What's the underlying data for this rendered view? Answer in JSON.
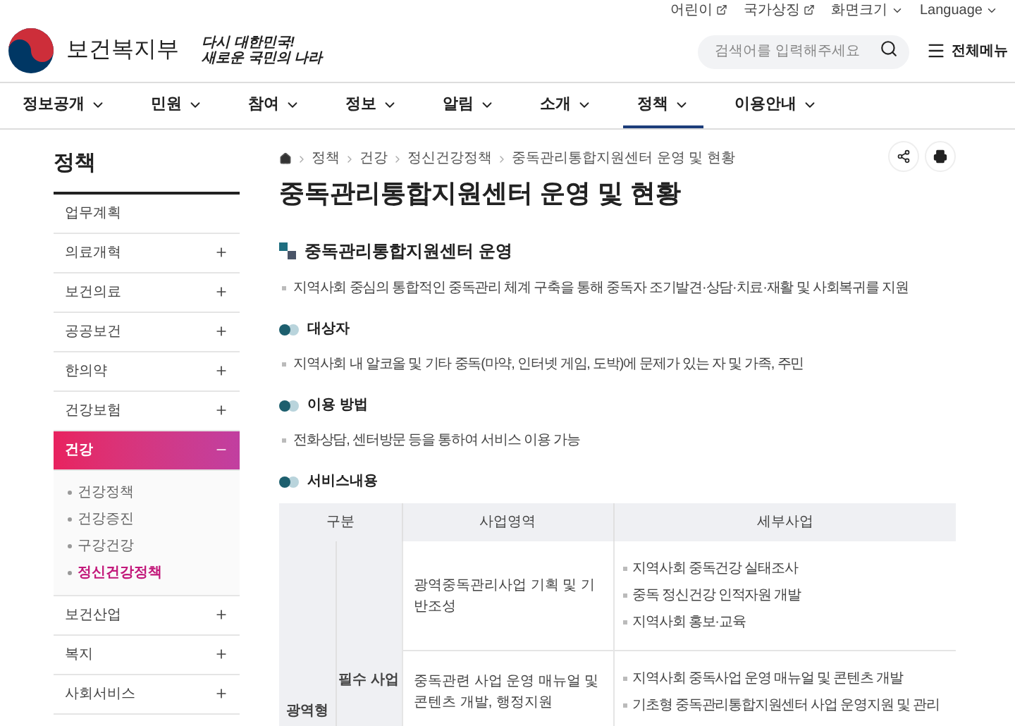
{
  "utility_links": [
    {
      "label": "어린이",
      "kind": "external"
    },
    {
      "label": "국가상징",
      "kind": "external"
    },
    {
      "label": "화면크기",
      "kind": "dropdown"
    },
    {
      "label": "Language",
      "kind": "dropdown"
    }
  ],
  "logo": {
    "name": "보건복지부",
    "slogan_lines": [
      "다시 대한민국!",
      "새로운 국민의 나라"
    ]
  },
  "search": {
    "placeholder": "검색어를 입력해주세요"
  },
  "all_menu": "전체메뉴",
  "nav": [
    {
      "label": "정보공개",
      "selected": false
    },
    {
      "label": "민원",
      "selected": false
    },
    {
      "label": "참여",
      "selected": false
    },
    {
      "label": "정보",
      "selected": false
    },
    {
      "label": "알림",
      "selected": false
    },
    {
      "label": "소개",
      "selected": false
    },
    {
      "label": "정책",
      "selected": true
    },
    {
      "label": "이용안내",
      "selected": false
    }
  ],
  "sidebar": {
    "title": "정책",
    "items": [
      {
        "label": "업무계획",
        "expandable": false,
        "expanded": false
      },
      {
        "label": "의료개혁",
        "expandable": true,
        "expanded": false
      },
      {
        "label": "보건의료",
        "expandable": true,
        "expanded": false
      },
      {
        "label": "공공보건",
        "expandable": true,
        "expanded": false
      },
      {
        "label": "한의약",
        "expandable": true,
        "expanded": false
      },
      {
        "label": "건강보험",
        "expandable": true,
        "expanded": false
      },
      {
        "label": "건강",
        "expandable": true,
        "expanded": true,
        "children": [
          {
            "label": "건강정책",
            "selected": false
          },
          {
            "label": "건강증진",
            "selected": false
          },
          {
            "label": "구강건강",
            "selected": false
          },
          {
            "label": "정신건강정책",
            "selected": true
          }
        ]
      },
      {
        "label": "보건산업",
        "expandable": true,
        "expanded": false
      },
      {
        "label": "복지",
        "expandable": true,
        "expanded": false
      },
      {
        "label": "사회서비스",
        "expandable": true,
        "expanded": false
      }
    ]
  },
  "breadcrumb": [
    "정책",
    "건강",
    "정신건강정책",
    "중독관리통합지원센터 운영 및 현황"
  ],
  "page_title": "중독관리통합지원센터 운영 및 현황",
  "sections": [
    {
      "kind": "main",
      "heading": "중독관리통합지원센터 운영",
      "bullets": [
        "지역사회 중심의 통합적인 중독관리 체계 구축을 통해 중독자 조기발견·상담·치료·재활 및 사회복귀를 지원"
      ]
    },
    {
      "kind": "sub",
      "heading": "대상자",
      "bullets": [
        "지역사회 내 알코올 및 기타 중독(마약, 인터넷 게임, 도박)에 문제가 있는 자 및 가족, 주민"
      ]
    },
    {
      "kind": "sub",
      "heading": "이용 방법",
      "bullets": [
        "전화상담, 센터방문 등을 통하여 서비스 이용 가능"
      ]
    },
    {
      "kind": "sub",
      "heading": "서비스내용"
    }
  ],
  "table": {
    "columns": [
      "구분",
      "사업영역",
      "세부사업"
    ],
    "group": "광역형",
    "subgroup": "필수 사업",
    "rows": [
      {
        "area": "광역중독관리사업 기획 및 기반조성",
        "details": [
          "지역사회 중독건강 실태조사",
          "중독 정신건강 인적자원 개발",
          "지역사회 홍보·교육"
        ]
      },
      {
        "area": "중독관련 사업 운영 매뉴얼 및 콘텐츠 개발, 행정지원",
        "details": [
          "지역사회 중독사업 운영 매뉴얼 및 콘텐츠 개발",
          "기초형 중독관리통합지원센터 사업 운영지원 및 관리"
        ]
      }
    ]
  }
}
